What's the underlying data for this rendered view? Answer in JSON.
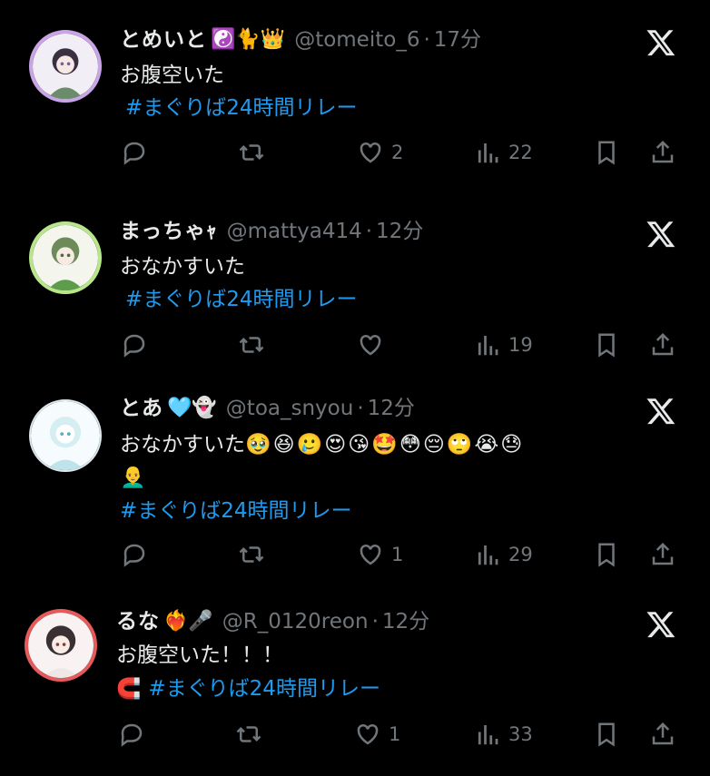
{
  "posts": [
    {
      "display_name": "とめいと",
      "name_emojis": "☯️🐈👑",
      "handle": "@tomeito_6",
      "separator": "·",
      "time": "17分",
      "text": "お腹空いた",
      "extra_emojis": "",
      "hashtag": "#まぐりば24時間リレー",
      "hashtag_prefix": "",
      "counts": {
        "reply": "",
        "repost": "",
        "like": "2",
        "views": "22"
      },
      "avatar_color": "#c9a5e8"
    },
    {
      "display_name": "まっちゃｬ",
      "name_emojis": "",
      "handle": "@mattya414",
      "separator": "·",
      "time": "12分",
      "text": "おなかすいた",
      "extra_emojis": "",
      "hashtag": "#まぐりば24時間リレー",
      "hashtag_prefix": "",
      "counts": {
        "reply": "",
        "repost": "",
        "like": "",
        "views": "19"
      },
      "avatar_color": "#b8e68a"
    },
    {
      "display_name": "とあ",
      "name_emojis": "🩵👻",
      "handle": "@toa_snyou",
      "separator": "·",
      "time": "12分",
      "text": "おなかすいた",
      "extra_emojis": "🥹😆🥲😍😘🤩😳😔🙄😭😓",
      "extra_emojis_2": "👨‍🦲",
      "hashtag": "#まぐりば24時間リレー",
      "hashtag_prefix": "",
      "counts": {
        "reply": "",
        "repost": "",
        "like": "1",
        "views": "29"
      },
      "avatar_color": "#e8f4f8"
    },
    {
      "display_name": "るな",
      "name_emojis": "❤️‍🔥🎤",
      "handle": "@R_0120reon",
      "separator": "·",
      "time": "12分",
      "text": "お腹空いた！！！",
      "extra_emojis": "",
      "hashtag": "#まぐりば24時間リレー",
      "hashtag_prefix": "🧲",
      "counts": {
        "reply": "",
        "repost": "",
        "like": "1",
        "views": "33"
      },
      "avatar_color": "#e85a5a"
    }
  ],
  "colors": {
    "background": "#000000",
    "text": "#e7e9ea",
    "muted": "#71767b",
    "link": "#1d9bf0"
  },
  "icons": [
    "reply-icon",
    "repost-icon",
    "like-icon",
    "views-icon",
    "bookmark-icon",
    "share-icon",
    "x-logo-icon"
  ]
}
